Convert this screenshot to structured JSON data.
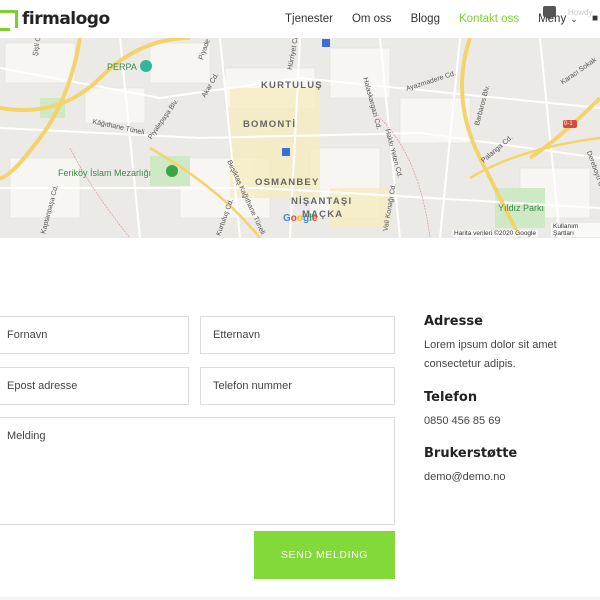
{
  "header": {
    "logo_text": "firmalogo",
    "nav": [
      "Tjenester",
      "Om oss",
      "Blogg",
      "Kontakt oss"
    ],
    "active_index": 3,
    "menu_label": "Meny",
    "ghost_text": "Howdy"
  },
  "map": {
    "districts": [
      "KURTULUŞ",
      "BOMONTİ",
      "OSMANBEY",
      "NİŞANTAŞI",
      "MAÇKA"
    ],
    "pois": [
      "PERPA",
      "Feriköy İslam Mezarlığı",
      "Yıldız Parkı"
    ],
    "streets": [
      "Kâğıthane Tüneli",
      "Piyalepaşa Blv.",
      "Akar Cd.",
      "Halaskargazi Cd.",
      "Ayazmadere Cd.",
      "Barbaros Blv.",
      "Karacı Sokak",
      "Hakkı Yeten Cd.",
      "Beşiktaş Kağıthane Tüneli",
      "Kurtuluş Cd.",
      "Vali Konağı Cd.",
      "Piyade Cd.",
      "Şişli Cd.",
      "Dereboyu Cd.",
      "Palanga Cd.",
      "Kaptanpaşa Cd.",
      "Hürriyet Cd."
    ],
    "badge": "0-1",
    "attribution": "Harita verileri ©2020 Google",
    "terms": "Kullanım Şartları",
    "google": [
      "G",
      "o",
      "o",
      "g",
      "l",
      "e"
    ]
  },
  "form": {
    "first_name": "Fornavn",
    "last_name": "Etternavn",
    "email": "Epost adresse",
    "phone": "Telefon nummer",
    "message": "Melding",
    "submit": "SEND MELDING"
  },
  "info": {
    "address_title": "Adresse",
    "address_text": "Lorem ipsum dolor sit amet consectetur adipis.",
    "phone_title": "Telefon",
    "phone_text": "0850 456 85 69",
    "support_title": "Brukerstøtte",
    "support_text": "demo@demo.no"
  },
  "colors": {
    "accent": "#7bd030",
    "button": "#83d83a"
  },
  "icons": [
    "logo-icon",
    "chevron-down-icon",
    "cart-icon",
    "chat-icon",
    "map-pin-icon",
    "metro-icon"
  ]
}
